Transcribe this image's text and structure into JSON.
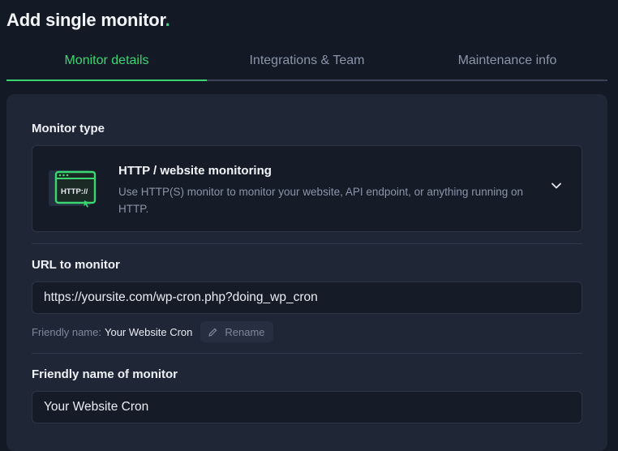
{
  "header": {
    "title": "Add single monitor",
    "title_dot": "."
  },
  "tabs": [
    {
      "label": "Monitor details",
      "active": true
    },
    {
      "label": "Integrations & Team",
      "active": false
    },
    {
      "label": "Maintenance info",
      "active": false
    }
  ],
  "monitor_type": {
    "label": "Monitor type",
    "selected_title": "HTTP / website monitoring",
    "selected_description": "Use HTTP(S) monitor to monitor your website, API endpoint, or anything running on HTTP.",
    "icon_text": "HTTP://",
    "icon": "http-monitor-icon"
  },
  "url_field": {
    "label": "URL to monitor",
    "value": "https://yoursite.com/wp-cron.php?doing_wp_cron"
  },
  "friendly_hint": {
    "prefix": "Friendly name:",
    "value": "Your Website Cron",
    "rename_label": "Rename"
  },
  "friendly_name_field": {
    "label": "Friendly name of monitor",
    "value": "Your Website Cron"
  },
  "colors": {
    "accent": "#3bd671",
    "background": "#131a26",
    "card": "#1f2636",
    "input": "#151b27"
  }
}
